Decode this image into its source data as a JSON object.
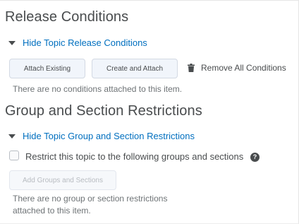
{
  "release": {
    "title": "Release Conditions",
    "toggle_label": "Hide Topic Release Conditions",
    "attach_existing_label": "Attach Existing",
    "create_attach_label": "Create and Attach",
    "remove_all_label": "Remove All Conditions",
    "empty_note": "There are no conditions attached to this item."
  },
  "groups": {
    "title": "Group and Section Restrictions",
    "toggle_label": "Hide Topic Group and Section Restrictions",
    "restrict_label": "Restrict this topic to the following groups and sections",
    "restrict_checked": false,
    "help_glyph": "?",
    "add_button_label": "Add Groups and Sections",
    "empty_note_line1": "There are no group or section restrictions",
    "empty_note_line2": "attached to this item."
  },
  "icons": {
    "caret": "caret-down-icon",
    "trash": "trash-icon",
    "help": "help-icon"
  },
  "colors": {
    "link": "#006fbf",
    "text": "#494c4e",
    "muted_text": "#6e7376",
    "button_bg": "#f1f5fb",
    "disabled_text": "#b8bcc1"
  }
}
